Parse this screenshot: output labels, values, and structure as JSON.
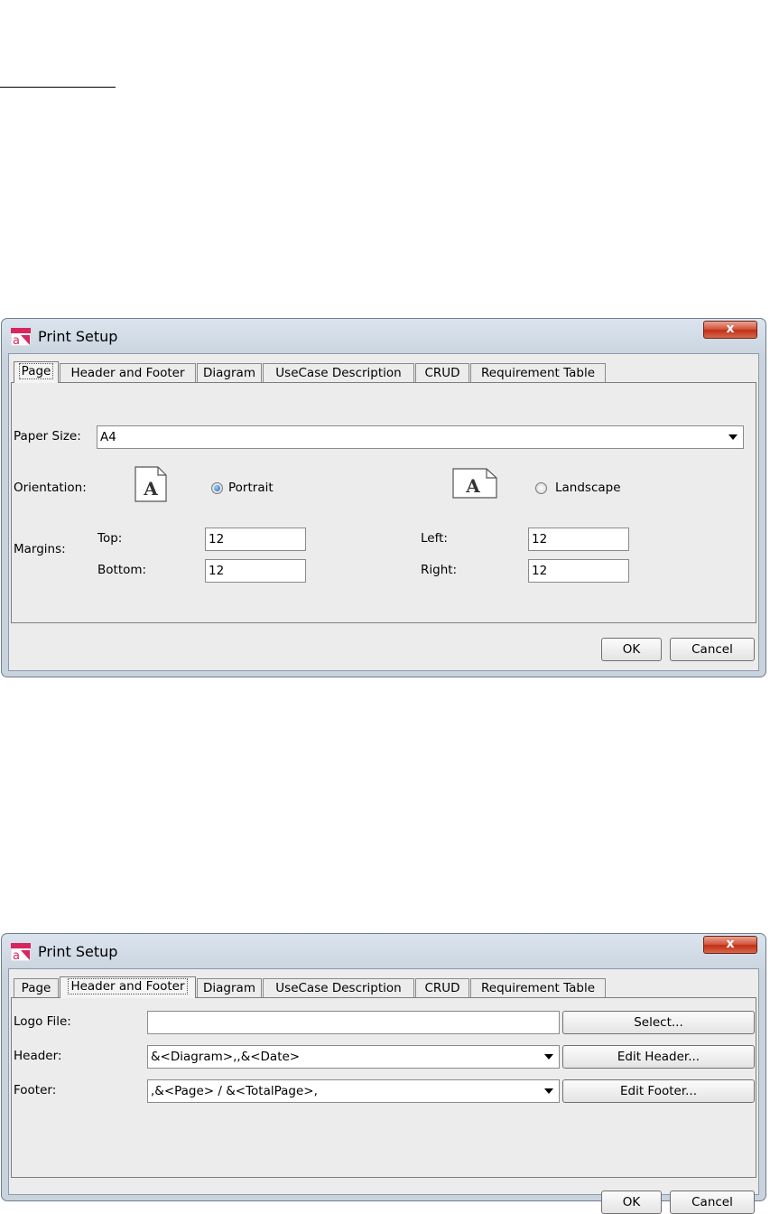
{
  "dialogs": [
    {
      "title": "Print Setup",
      "close_label": "x",
      "tabs": [
        "Page",
        "Header and Footer",
        "Diagram",
        "UseCase Description",
        "CRUD",
        "Requirement Table"
      ],
      "active_tab": "Page",
      "paper_size": {
        "label": "Paper Size:",
        "value": "A4"
      },
      "orientation": {
        "label": "Orientation:",
        "icon_letter": "A",
        "portrait_label": "Portrait",
        "landscape_label": "Landscape",
        "selected": "Portrait"
      },
      "margins": {
        "label": "Margins:",
        "top_label": "Top:",
        "top_value": "12",
        "bottom_label": "Bottom:",
        "bottom_value": "12",
        "left_label": "Left:",
        "left_value": "12",
        "right_label": "Right:",
        "right_value": "12"
      },
      "ok_label": "OK",
      "cancel_label": "Cancel"
    },
    {
      "title": "Print Setup",
      "close_label": "x",
      "tabs": [
        "Page",
        "Header and Footer",
        "Diagram",
        "UseCase Description",
        "CRUD",
        "Requirement Table"
      ],
      "active_tab": "Header and Footer",
      "logo_file": {
        "label": "Logo File:",
        "value": "",
        "button_label": "Select..."
      },
      "header": {
        "label": "Header:",
        "value": "&<Diagram>,,&<Date>",
        "button_label": "Edit Header..."
      },
      "footer": {
        "label": "Footer:",
        "value": ",&<Page> / &<TotalPage>,",
        "button_label": "Edit Footer..."
      },
      "ok_label": "OK",
      "cancel_label": "Cancel"
    }
  ],
  "colors": {
    "close_button": "#c9452b",
    "radio_selected": "#1f62b8",
    "app_icon_pink": "#d7265f"
  }
}
